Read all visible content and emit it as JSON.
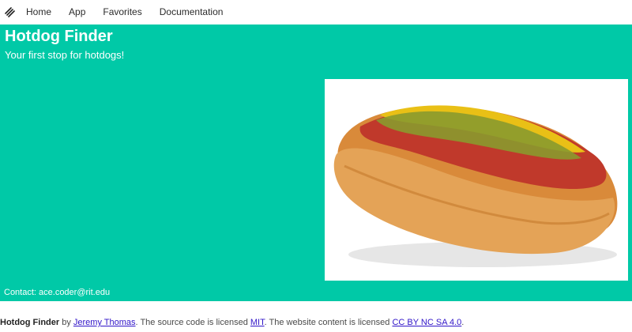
{
  "navbar": {
    "brand_icon": "stacked-slash-logo-icon",
    "items": [
      {
        "label": "Home"
      },
      {
        "label": "App"
      },
      {
        "label": "Favorites"
      },
      {
        "label": "Documentation"
      }
    ]
  },
  "hero": {
    "title": "Hotdog Finder",
    "subtitle": "Your first stop for hotdogs!",
    "image_icon": "hotdog-photo",
    "contact": "Contact: ace.coder@rit.edu",
    "background_color": "#00c9a7"
  },
  "footer": {
    "brand": "Hotdog Finder",
    "by_text": " by ",
    "author_link": "Jeremy Thomas",
    "source_text": ". The source code is licensed ",
    "source_license_link": "MIT",
    "content_text": ". The website content is licensed ",
    "content_license_link": "CC BY NC SA 4.0",
    "end_text": "."
  }
}
